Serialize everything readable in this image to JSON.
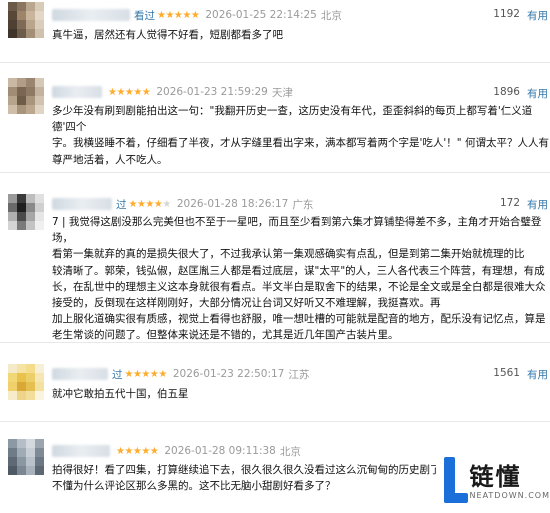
{
  "colors": {
    "star": "#ffac2d",
    "link": "#3377aa",
    "meta": "#9a9a9a"
  },
  "comments": [
    {
      "name_tail": "看过",
      "stars": "★★★★★",
      "stars_off": "",
      "time": "2026-01-25 22:14:25",
      "location": "北京",
      "votes": "1192",
      "useful_label": "有用",
      "lines": [
        "真牛逼，居然还有人觉得不好看，短剧都看多了吧"
      ]
    },
    {
      "name_tail": "",
      "stars": "★★★★★",
      "stars_off": "",
      "time": "2026-01-23 21:59:29",
      "location": "天津",
      "votes": "1896",
      "useful_label": "有用",
      "lines": [
        "多少年没有刷到剧能拍出这一句：\"我翻开历史一查，这历史没有年代，歪歪斜斜的每页上都写着'仁义道德'四个",
        "字。我横竖睡不着，仔细看了半夜，才从字缝里看出字来，满本都写着两个字是'吃人'！\" 何谓太平？人人有",
        "尊严地活着，人不吃人。"
      ]
    },
    {
      "name_tail": "过",
      "stars": "★★★★",
      "stars_off": "★",
      "time": "2026-01-28 18:26:17",
      "location": "广东",
      "votes": "172",
      "useful_label": "有用",
      "lines": [
        "7 | 我觉得这剧没那么完美但也不至于一星吧，而且至少看到第六集才算铺垫得差不多，主角才开始合璧登场，",
        "看第一集就弃的真的是损失很大了，不过我承认第一集观感确实有点乱，但是到第二集开始就梳理的比",
        "较清晰了。郭荣，钱弘俶，赵匡胤三人都是看过底层，谋\"太平\"的人，三人各代表三个阵营，有理想，有成",
        "长，在乱世中的理想主义这本身就很有看点。半文半白是取舍下的结果，不论是全文或是全白都是很难大众",
        "接受的，反倒现在这样刚刚好，大部分情况让台词又好听又不难理解，我挺喜欢。再",
        "加上服化道确实很有质感，视觉上看得也舒服，唯一想吐槽的可能就是配音的地方，配乐没有记忆点，算是",
        "老生常谈的问题了。但整体来说还是不错的，尤其是近几年国产古装片里。"
      ]
    },
    {
      "name_tail": "过",
      "stars": "★★★★★",
      "stars_off": "",
      "time": "2026-01-23 22:50:17",
      "location": "江苏",
      "votes": "1561",
      "useful_label": "有用",
      "lines": [
        "就冲它敢拍五代十国，伯五星"
      ]
    },
    {
      "name_tail": "",
      "stars": "★★★★★",
      "stars_off": "",
      "time": "2026-01-28 09:11:38",
      "location": "北京",
      "votes": "",
      "useful_label": "",
      "lines": [
        "拍得很好！看了四集，打算继续追下去，很久很久很久没看过这么沉甸甸的历史剧了。不",
        "不懂为什么评论区那么多黑的。这不比无脑小甜剧好看多了？"
      ]
    }
  ],
  "watermark": {
    "cn": "链懂",
    "en": "NEATDOWN.COM"
  }
}
